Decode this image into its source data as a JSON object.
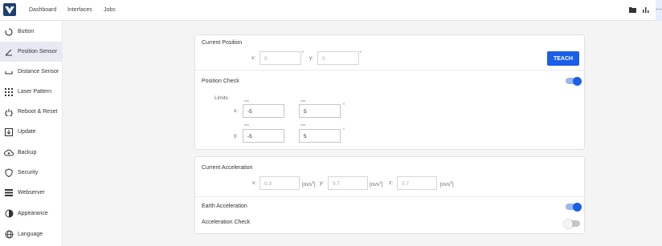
{
  "nav": {
    "dashboard": "Dashboard",
    "interfaces": "Interfaces",
    "jobs": "Jobs"
  },
  "sidebar": {
    "items": [
      {
        "label": "Button",
        "icon": "ring-icon"
      },
      {
        "label": "Position Sensor",
        "icon": "angle-icon",
        "active": true
      },
      {
        "label": "Distance Sensor",
        "icon": "distance-icon"
      },
      {
        "label": "Laser Pattern",
        "icon": "grid-icon"
      },
      {
        "label": "Reboot & Reset",
        "icon": "power-icon"
      },
      {
        "label": "Update",
        "icon": "download-icon"
      },
      {
        "label": "Backup",
        "icon": "cloud-icon"
      },
      {
        "label": "Security",
        "icon": "shield-icon"
      },
      {
        "label": "Webserver",
        "icon": "server-icon"
      },
      {
        "label": "Appearance",
        "icon": "appearance-icon"
      },
      {
        "label": "Language",
        "icon": "globe-icon"
      }
    ]
  },
  "position_card": {
    "current_position": {
      "title": "Current Position",
      "x_label": "x:",
      "x_value": "0",
      "x_unit": "°",
      "y_label": "y:",
      "y_value": "0",
      "y_unit": "°",
      "teach_label": "TEACH"
    },
    "position_check": {
      "title": "Position Check",
      "enabled": true,
      "limits_label": "Limits",
      "min_label": "min",
      "max_label": "max",
      "x_label": "x:",
      "x_min": "-5",
      "x_max": "5",
      "x_unit": "°",
      "y_label": "y:",
      "y_min": "-5",
      "y_max": "5",
      "y_unit": "°"
    }
  },
  "acceleration_card": {
    "current_acceleration": {
      "title": "Current Acceleration",
      "x_label": "x:",
      "x_value": "0.3",
      "y_label": "y:",
      "y_value": "9.7",
      "z_label": "z:",
      "z_value": "0.7",
      "unit_base": "[m/s",
      "unit_exp": "2",
      "unit_close": "]"
    },
    "earth_acceleration": {
      "title": "Earth Acceleration",
      "enabled": true
    },
    "acceleration_check": {
      "title": "Acceleration Check",
      "enabled": false
    }
  },
  "colors": {
    "accent": "#1b5ee8",
    "toggle_track_on": "#9cb6ee",
    "toggle_off": "#c6c6c6",
    "active_item_bg": "#e7eaf2",
    "logo": "#1d3f73"
  }
}
